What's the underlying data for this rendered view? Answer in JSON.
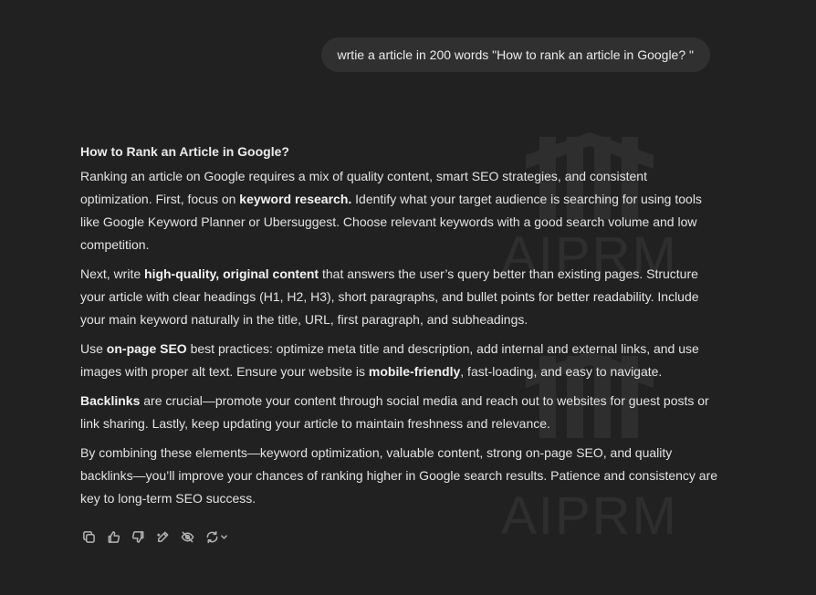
{
  "user_message": "wrtie a article in 200 words \"How to rank an article in Google? \"",
  "watermark_text": "AIPRM",
  "response": {
    "title": "How to Rank an Article in Google?",
    "paragraphs": [
      [
        {
          "text": "Ranking an article on Google requires a mix of quality content, smart SEO strategies, and consistent optimization. First, focus on ",
          "bold": false
        },
        {
          "text": "keyword research.",
          "bold": true
        },
        {
          "text": " Identify what your target audience is searching for using tools like Google Keyword Planner or Ubersuggest. Choose relevant keywords with a good search volume and low competition.",
          "bold": false
        }
      ],
      [
        {
          "text": "Next, write ",
          "bold": false
        },
        {
          "text": "high-quality, original content",
          "bold": true
        },
        {
          "text": " that answers the user’s query better than existing pages. Structure your article with clear headings (H1, H2, H3), short paragraphs, and bullet points for better readability. Include your main keyword naturally in the title, URL, first paragraph, and subheadings.",
          "bold": false
        }
      ],
      [
        {
          "text": "Use ",
          "bold": false
        },
        {
          "text": "on-page SEO",
          "bold": true
        },
        {
          "text": " best practices: optimize meta title and description, add internal and external links, and use images with proper alt text. Ensure your website is ",
          "bold": false
        },
        {
          "text": "mobile-friendly",
          "bold": true
        },
        {
          "text": ", fast-loading, and easy to navigate.",
          "bold": false
        }
      ],
      [
        {
          "text": "Backlinks",
          "bold": true
        },
        {
          "text": " are crucial—promote your content through social media and reach out to websites for guest posts or link sharing. Lastly, keep updating your article to maintain freshness and relevance.",
          "bold": false
        }
      ],
      [
        {
          "text": "By combining these elements—keyword optimization, valuable content, strong on-page SEO, and quality backlinks—you’ll improve your chances of ranking higher in Google search results. Patience and consistency are key to long-term SEO success.",
          "bold": false
        }
      ]
    ]
  },
  "actions": [
    {
      "icon": "copy-icon"
    },
    {
      "icon": "thumbs-up-icon"
    },
    {
      "icon": "thumbs-down-icon"
    },
    {
      "icon": "edit-icon"
    },
    {
      "icon": "hide-icon"
    },
    {
      "icon": "regenerate-icon"
    }
  ],
  "colors": {
    "background": "#212121",
    "user_bubble": "#303030",
    "text": "#ececec",
    "icon": "#b4b4b4"
  }
}
